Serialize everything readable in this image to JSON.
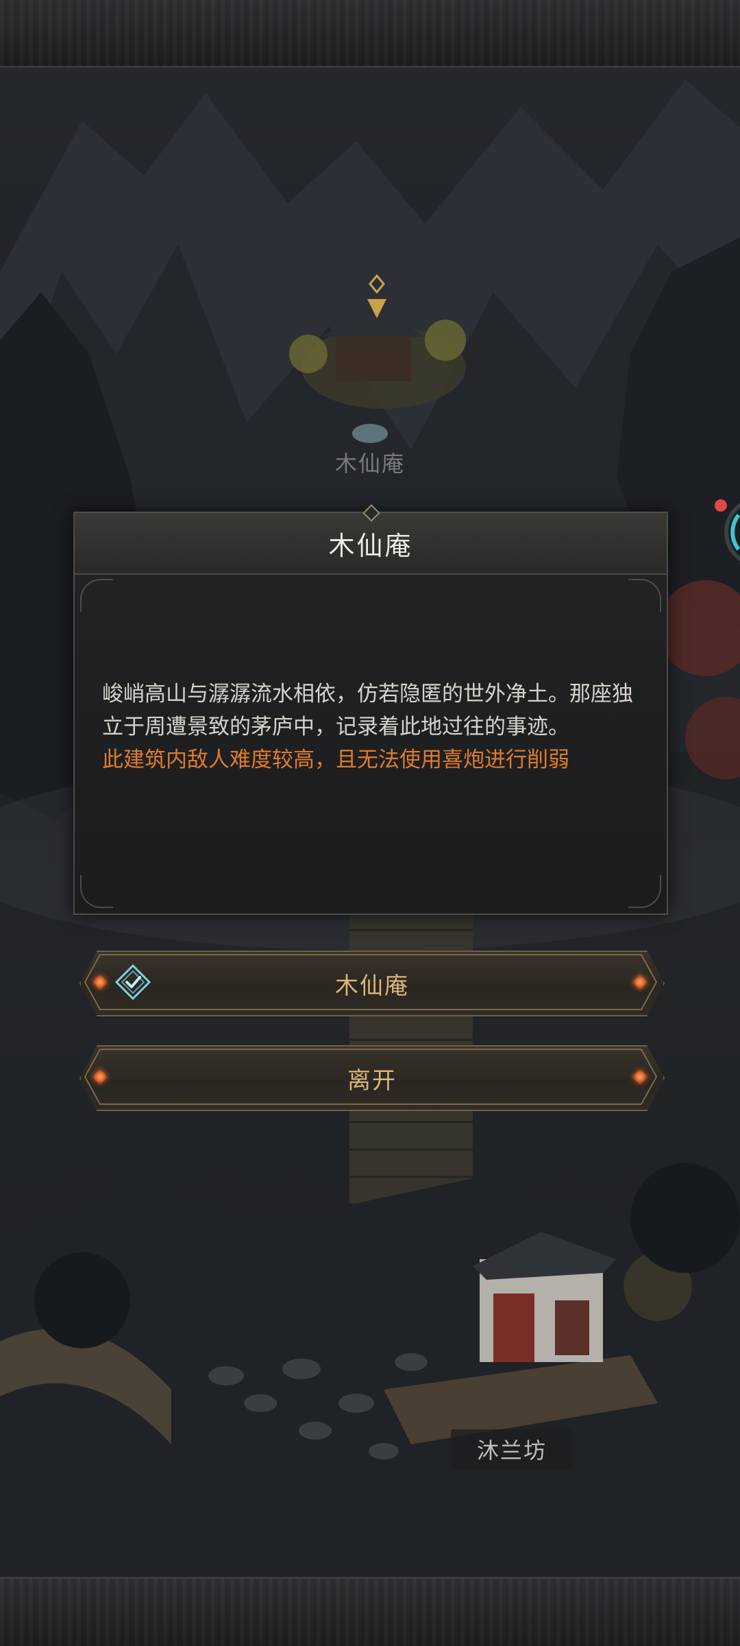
{
  "map": {
    "location_top": "木仙庵",
    "location_bottom": "沐兰坊"
  },
  "dialog": {
    "title": "木仙庵",
    "description": "峻峭高山与潺潺流水相依，仿若隐匿的世外净土。那座独立于周遭景致的茅庐中，记录着此地过往的事迹。",
    "warning": "此建筑内敌人难度较高，且无法使用喜炮进行削弱"
  },
  "options": [
    {
      "label": "木仙庵",
      "icon": "checkmark-diamond-icon"
    },
    {
      "label": "离开"
    }
  ],
  "colors": {
    "warning": "#e07c2c",
    "option_text": "#d9b678",
    "gem": "#e0632a",
    "check_icon": "#7fd0de"
  }
}
